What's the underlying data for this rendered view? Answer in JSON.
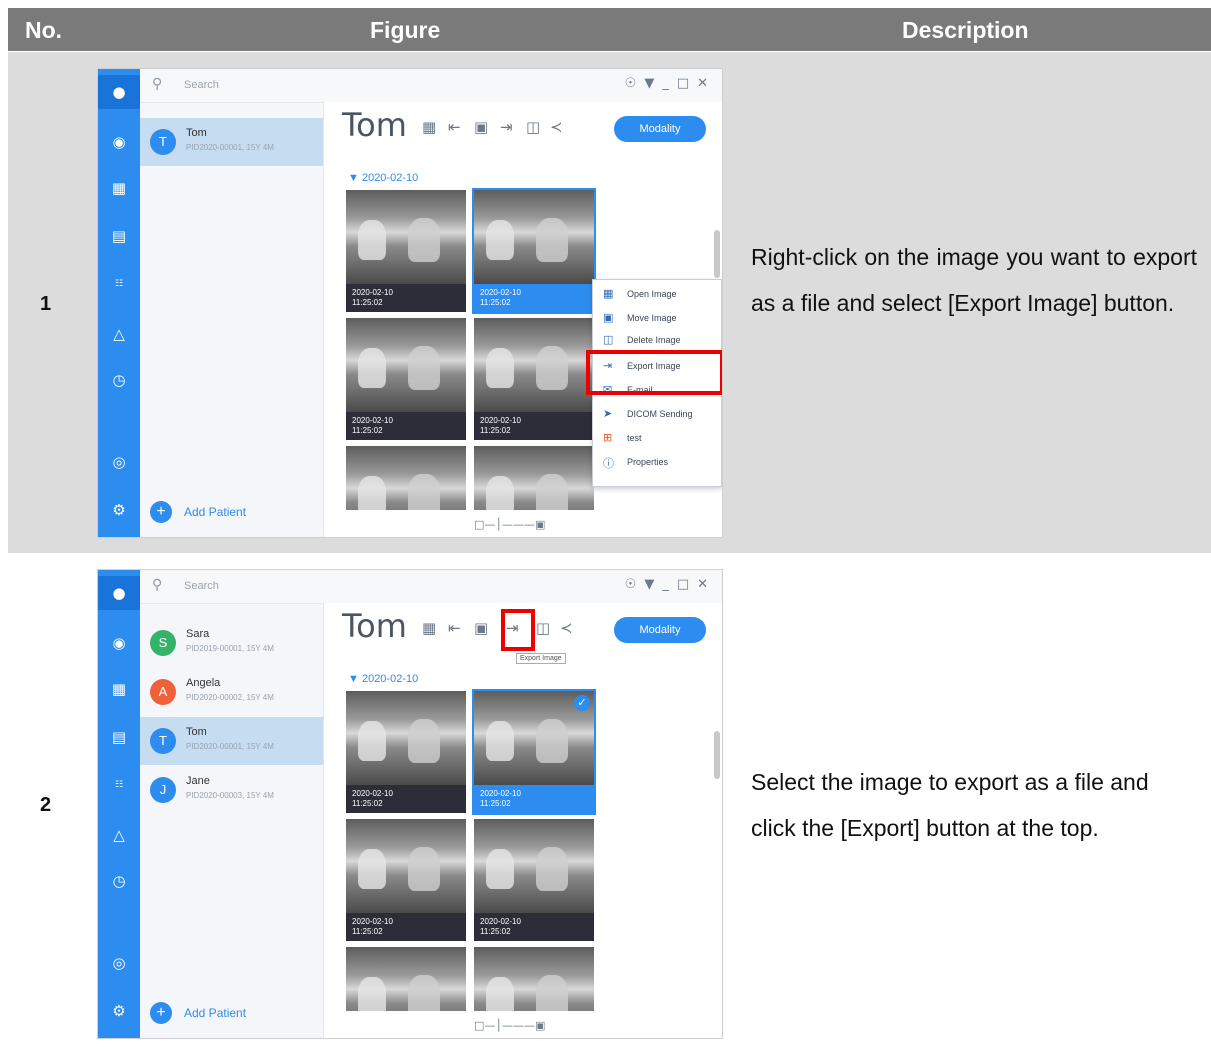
{
  "header": {
    "col_no": "No.",
    "col_figure": "Figure",
    "col_description": "Description"
  },
  "rows": [
    {
      "number": "1",
      "description": "Right-click on the image you want to export as a file and select [Export Image] button.",
      "app": {
        "search_placeholder": "Search",
        "patients": [
          {
            "initial": "T",
            "name": "Tom",
            "pid": "PID2020-00001, 15Y 4M",
            "color": "#2d8cf0"
          }
        ],
        "add_patient": "Add Patient",
        "title": "Tom",
        "modality": "Modality",
        "date": "2020-02-10",
        "thumbs": [
          {
            "date": "2020-02-10",
            "time": "11:25:02"
          },
          {
            "date": "2020-02-10",
            "time": "11:25:02"
          },
          {
            "date": "2020-02-10",
            "time": "11:25:02"
          },
          {
            "date": "2020-02-10",
            "time": "11:25:02"
          }
        ],
        "context_menu": [
          "Open Image",
          "Move Image",
          "Delete Image",
          "Export Image",
          "E-mail",
          "DICOM Sending",
          "test",
          "Properties"
        ]
      }
    },
    {
      "number": "2",
      "description": "Select the image to export as a file and click the [Export] button at the top.",
      "app": {
        "search_placeholder": "Search",
        "patients": [
          {
            "initial": "S",
            "name": "Sara",
            "pid": "PID2019-00001, 15Y 4M",
            "color": "#34b36b"
          },
          {
            "initial": "A",
            "name": "Angela",
            "pid": "PID2020-00002, 15Y 4M",
            "color": "#f0603a"
          },
          {
            "initial": "T",
            "name": "Tom",
            "pid": "PID2020-00001, 15Y 4M",
            "color": "#2d8cf0"
          },
          {
            "initial": "J",
            "name": "Jane",
            "pid": "PID2020-00003, 15Y 4M",
            "color": "#2d8cf0"
          }
        ],
        "add_patient": "Add Patient",
        "title": "Tom",
        "modality": "Modality",
        "tooltip": "Export Image",
        "date": "2020-02-10",
        "thumbs": [
          {
            "date": "2020-02-10",
            "time": "11:25:02"
          },
          {
            "date": "2020-02-10",
            "time": "11:25:02"
          },
          {
            "date": "2020-02-10",
            "time": "11:25:02"
          },
          {
            "date": "2020-02-10",
            "time": "11:25:02"
          }
        ]
      }
    }
  ]
}
